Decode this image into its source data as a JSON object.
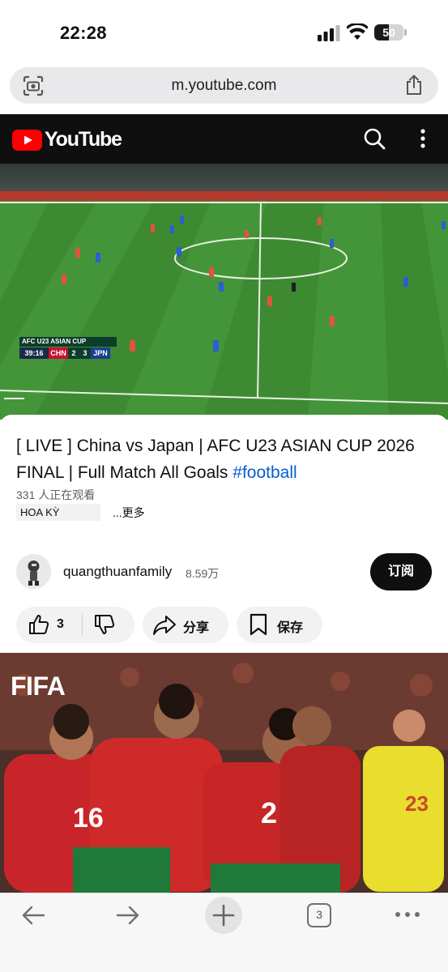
{
  "status_bar": {
    "time": "22:28",
    "battery": "50"
  },
  "browser": {
    "url": "m.youtube.com",
    "open_tabs": "3"
  },
  "youtube": {
    "logo_text": "YouTube",
    "colors": {
      "brand_red": "#ff0000",
      "header_bg": "#0f0f0f",
      "link_blue": "#065fd4"
    }
  },
  "video": {
    "scoreboard": {
      "title": "AFC U23 ASIAN CUP",
      "clock": "39:16",
      "team_home": "CHN",
      "score_home": "2",
      "score_away": "3",
      "team_away": "JPN"
    },
    "title_text": "[ LIVE ] China vs Japan | AFC U23 ASIAN CUP 2026 FINAL | Full Match All Goals ",
    "title_hashtag": "#football",
    "viewers": "331 人正在观看",
    "location_chip": "HOA KỲ",
    "more_label": "...更多"
  },
  "channel": {
    "name": "quangthuanfamily",
    "subscribers": "8.59万",
    "subscribe_label": "订阅"
  },
  "actions": {
    "like_count": "3",
    "share_label": "分享",
    "save_label": "保存"
  },
  "next_thumbnail": {
    "brand": "FIFA"
  },
  "icons": [
    "camera-scan-icon",
    "share-icon",
    "youtube-logo-icon",
    "search-icon",
    "more-vertical-icon",
    "thumbs-up-icon",
    "thumbs-down-icon",
    "share-arrow-icon",
    "bookmark-icon",
    "back-arrow-icon",
    "forward-arrow-icon",
    "plus-icon",
    "tabs-icon",
    "more-horizontal-icon"
  ]
}
